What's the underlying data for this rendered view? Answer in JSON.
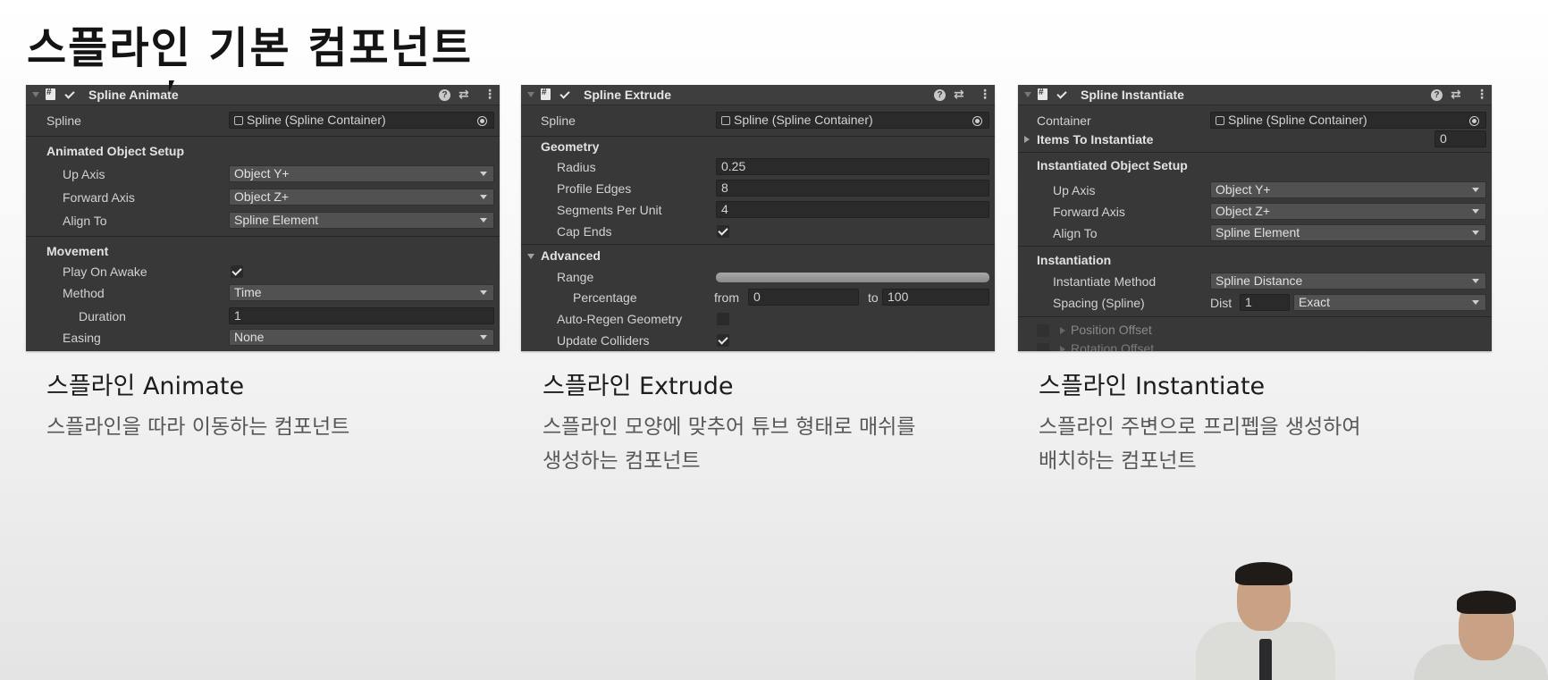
{
  "slide": {
    "title": "스플라인 기본 컴포넌트"
  },
  "panels": {
    "animate": {
      "header": "Spline Animate",
      "spline_label": "Spline",
      "spline_value": "Spline (Spline Container)",
      "setup_header": "Animated Object Setup",
      "up_axis_label": "Up Axis",
      "up_axis_value": "Object Y+",
      "forward_axis_label": "Forward Axis",
      "forward_axis_value": "Object Z+",
      "align_to_label": "Align To",
      "align_to_value": "Spline Element",
      "movement_header": "Movement",
      "play_on_awake_label": "Play On Awake",
      "method_label": "Method",
      "method_value": "Time",
      "duration_label": "Duration",
      "duration_value": "1",
      "easing_label": "Easing",
      "easing_value": "None"
    },
    "extrude": {
      "header": "Spline Extrude",
      "spline_label": "Spline",
      "spline_value": "Spline (Spline Container)",
      "geometry_header": "Geometry",
      "radius_label": "Radius",
      "radius_value": "0.25",
      "profile_edges_label": "Profile Edges",
      "profile_edges_value": "8",
      "segments_label": "Segments Per Unit",
      "segments_value": "4",
      "cap_ends_label": "Cap Ends",
      "advanced_header": "Advanced",
      "range_label": "Range",
      "percentage_label": "Percentage",
      "from_label": "from",
      "from_value": "0",
      "to_label": "to",
      "to_value": "100",
      "auto_regen_label": "Auto-Regen Geometry",
      "update_colliders_label": "Update Colliders"
    },
    "instantiate": {
      "header": "Spline Instantiate",
      "container_label": "Container",
      "container_value": "Spline (Spline Container)",
      "items_label": "Items To Instantiate",
      "items_value": "0",
      "setup_header": "Instantiated Object Setup",
      "up_axis_label": "Up Axis",
      "up_axis_value": "Object Y+",
      "forward_axis_label": "Forward Axis",
      "forward_axis_value": "Object Z+",
      "align_to_label": "Align To",
      "align_to_value": "Spline Element",
      "instantiation_header": "Instantiation",
      "method_label": "Instantiate Method",
      "method_value": "Spline Distance",
      "spacing_label": "Spacing (Spline)",
      "dist_label": "Dist",
      "dist_value": "1",
      "spacing_mode_value": "Exact",
      "position_offset_label": "Position Offset",
      "rotation_offset_label": "Rotation Offset"
    }
  },
  "captions": [
    {
      "title": "스플라인 Animate",
      "desc": [
        "스플라인을 따라 이동하는 컴포넌트"
      ]
    },
    {
      "title": "스플라인 Extrude",
      "desc": [
        "스플라인 모양에 맞추어 튜브 형태로 매쉬를",
        "생성하는 컴포넌트"
      ]
    },
    {
      "title": "스플라인 Instantiate",
      "desc": [
        "스플라인 주변으로 프리펩을 생성하여",
        "배치하는 컴포넌트"
      ]
    }
  ]
}
